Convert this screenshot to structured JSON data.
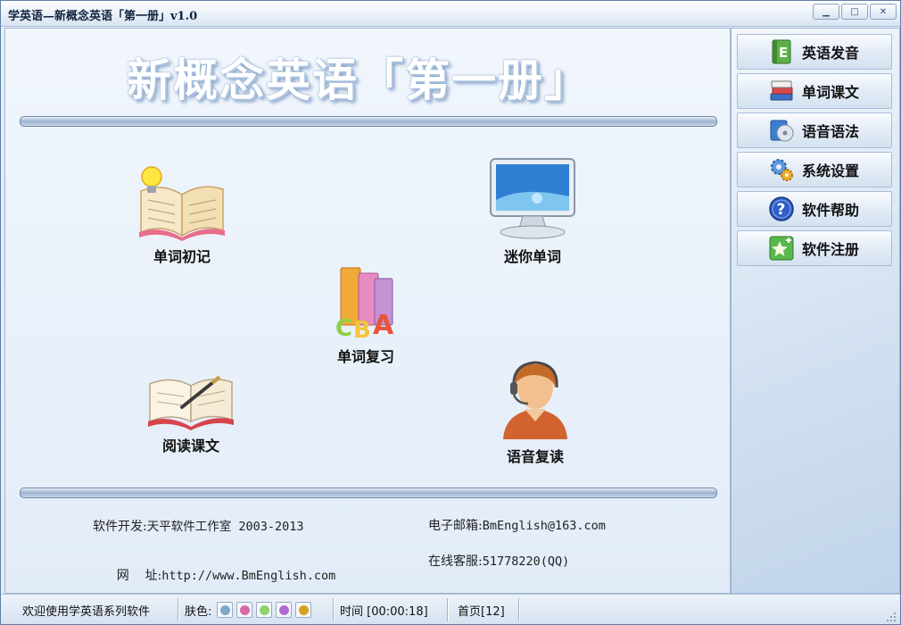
{
  "window": {
    "title": "学英语—新概念英语「第一册」v1.0"
  },
  "banner": {
    "title": "新概念英语「第一册」"
  },
  "tiles": {
    "word_first": "单词初记",
    "mini_word": "迷你单词",
    "word_review": "单词复习",
    "read_text": "阅读课文",
    "voice_repeat": "语音复读"
  },
  "info": {
    "dev_label": "软件开发:",
    "dev_value": "天平软件工作室 2003-2013",
    "email_label": "电子邮箱:",
    "email_value": "BmEnglish@163.com",
    "site_label": "网    址:",
    "site_value": "http://www.BmEnglish.com",
    "service_label": "在线客服:",
    "service_value": "51778220(QQ)"
  },
  "sidebar": {
    "items": [
      {
        "label": "英语发音",
        "icon": "e-book-icon"
      },
      {
        "label": "单词课文",
        "icon": "books-stack-icon"
      },
      {
        "label": "语音语法",
        "icon": "media-cd-icon"
      },
      {
        "label": "系统设置",
        "icon": "gears-icon"
      },
      {
        "label": "软件帮助",
        "icon": "help-icon"
      },
      {
        "label": "软件注册",
        "icon": "register-star-icon"
      }
    ]
  },
  "status": {
    "welcome": "欢迎使用学英语系列软件",
    "skin_label": "肤色:",
    "skin_colors": [
      "#7fa7c9",
      "#d86aa8",
      "#8fd16a",
      "#b06ad0",
      "#d8a020"
    ],
    "time": "时间 [00:00:18]",
    "page": "首页[12]"
  }
}
